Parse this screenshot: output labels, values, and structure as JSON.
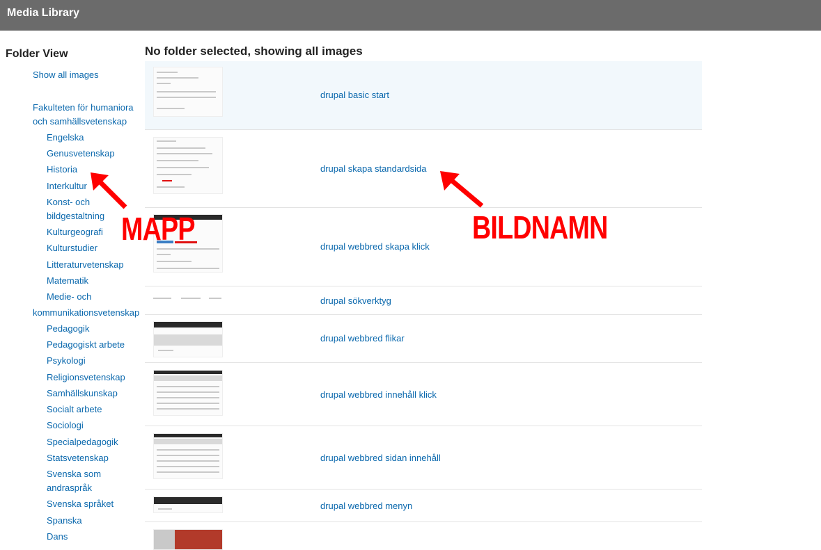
{
  "header": {
    "title": "Media Library"
  },
  "sidebar": {
    "heading": "Folder View",
    "show_all": "Show all images",
    "faculty_line1": "Fakulteten för humaniora",
    "faculty_line2": "och samhällsvetenskap",
    "folders": {
      "engelska": "Engelska",
      "genus": "Genusvetenskap",
      "historia": "Historia",
      "interkultur": "Interkultur",
      "konst1": "Konst- och",
      "konst2": "bildgestaltning",
      "kulturgeografi": "Kulturgeografi",
      "kulturstudier": "Kulturstudier",
      "litteratur": "Litteraturvetenskap",
      "matematik": "Matematik",
      "medie1": "Medie- och",
      "medie2": "kommunikationsvetenskap",
      "pedagogik": "Pedagogik",
      "ped_arbete": "Pedagogiskt arbete",
      "psykologi": "Psykologi",
      "religion": "Religionsvetenskap",
      "samhall": "Samhällskunskap",
      "socialt": "Socialt arbete",
      "sociologi": "Sociologi",
      "special": "Specialpedagogik",
      "stats": "Statsvetenskap",
      "svenska_som1": "Svenska som",
      "svenska_som2": "andraspråk",
      "svenska_sprak": "Svenska språket",
      "spanska": "Spanska",
      "dans": "Dans"
    }
  },
  "main": {
    "title": "No folder selected, showing all images",
    "images": [
      "drupal basic start",
      "drupal skapa standardsida",
      "drupal webbred skapa klick",
      "drupal sökverktyg",
      "drupal webbred flikar",
      "drupal webbred innehåll klick",
      "drupal webbred sidan innehåll",
      "drupal webbred menyn"
    ]
  },
  "annotations": {
    "folder_label": "MAPP",
    "image_label": "BILDNAMN"
  },
  "colors": {
    "header_bg": "#6b6b6b",
    "link": "#0a68ad",
    "annotation": "#ff0000",
    "row_highlight": "#f2f8fc"
  },
  "icons": [
    "red-arrow-icon"
  ]
}
